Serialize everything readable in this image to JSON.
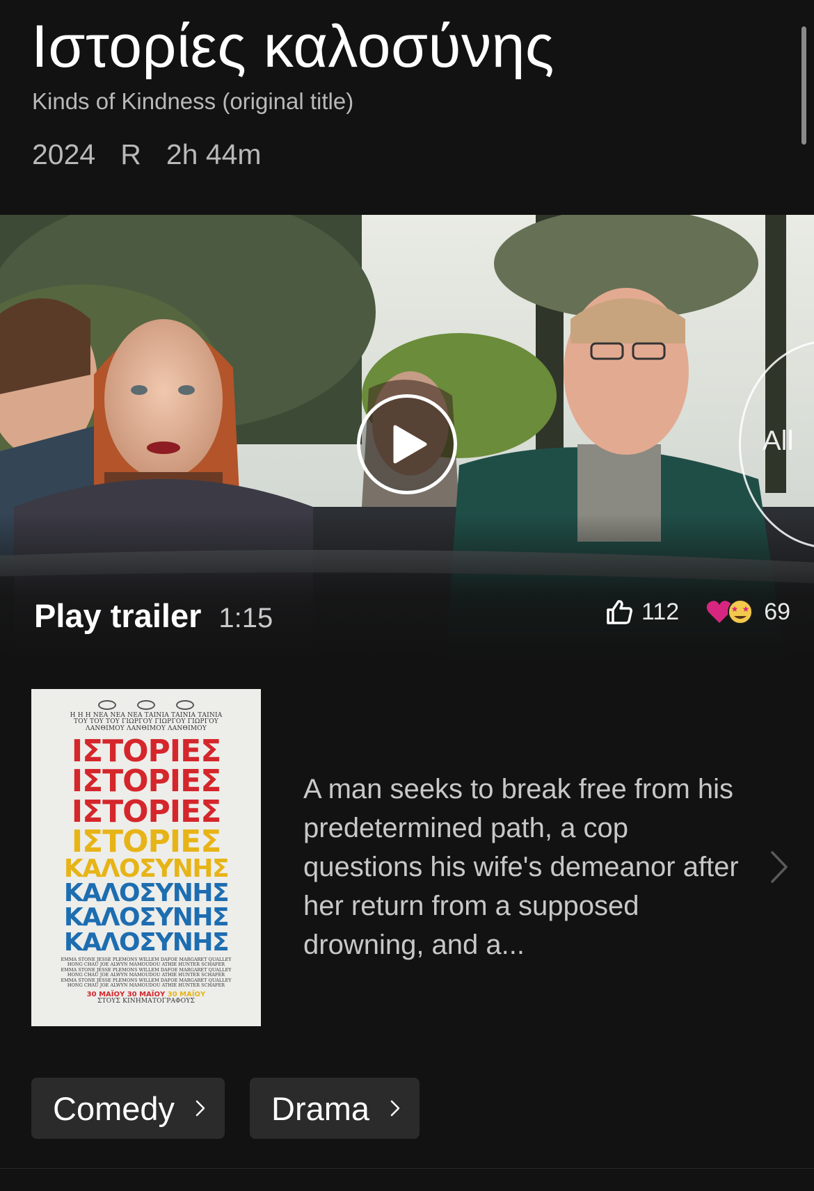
{
  "title": "Ιστορίες καλοσύνης",
  "original_title": "Kinds of Kindness (original title)",
  "meta": {
    "year": "2024",
    "rating": "R",
    "runtime": "2h 44m"
  },
  "hero": {
    "all_label": "All",
    "trailer_label": "Play trailer",
    "trailer_duration": "1:15",
    "likes": "112",
    "reactions": "69"
  },
  "poster": {
    "top_lines": [
      "Η Η Η ΝΕΑ ΝΕΑ ΝΕΑ ΤΑΙΝΙΑ ΤΑΙΝΙΑ ΤΑΙΝΙΑ",
      "ΤΟΥ ΤΟΥ ΤΟΥ ΓΙΩΡΓΟΥ ΓΙΩΡΓΟΥ ΓΙΩΡΓΟΥ",
      "ΛΑΝΘΙΜΟΥ ΛΑΝΘΙΜΟΥ ΛΑΝΘΙΜΟΥ"
    ],
    "word1": "ΙΣΤΟΡΙΕΣ",
    "word2": "ΚΑΛΟΣΥΝΗΣ",
    "cast_lines": [
      "EMMA STONE JESSE PLEMONS WILLEM DAFOE MARGARET QUALLEY",
      "HONG CHAU JOE ALWYN MAMOUDOU ATHIE HUNTER SCHAFER",
      "EMMA STONE JESSE PLEMONS WILLEM DAFOE MARGARET QUALLEY",
      "HONG CHAU JOE ALWYN MAMOUDOU ATHIE HUNTER SCHAFER",
      "EMMA STONE JESSE PLEMONS WILLEM DAFOE MARGARET QUALLEY",
      "HONG CHAU JOE ALWYN MAMOUDOU ATHIE HUNTER SCHAFER"
    ],
    "date_a": "30 ΜΑΪΟΥ 30 ΜΑΪΟΥ",
    "date_b": "30 ΜΑΪΟΥ",
    "date_sub": "ΣΤΟΥΣ ΚΙΝΗΜΑΤΟΓΡΑΦΟΥΣ"
  },
  "description": "A man seeks to break free from his predetermined path, a cop questions his wife's demeanor after her return from a supposed drowning, and a...",
  "genres": [
    "Comedy",
    "Drama"
  ],
  "colors": {
    "background": "#121212",
    "chip": "#2b2b2b",
    "heart": "#d6267f"
  }
}
